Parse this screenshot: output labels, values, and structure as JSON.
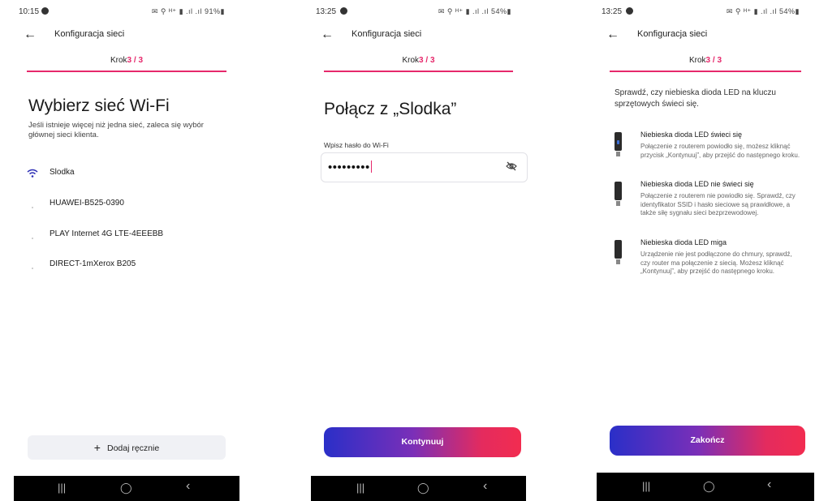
{
  "screens": [
    {
      "time": "10:15",
      "status_right": "✉ ⚲ ᴴ⁺ ▮ .ıl .ıl 91%▮",
      "title": "Konfiguracja sieci",
      "step_label": "Krok",
      "step_num": "3 / 3",
      "heading": "Wybierz sieć Wi-Fi",
      "subtitle": "Jeśli istnieje więcej niż jedna sieć, zaleca się wybór głównej sieci klienta.",
      "networks": [
        {
          "name": "Slodka",
          "icon": "wifi-icon"
        },
        {
          "name": "HUAWEI-B525-0390",
          "icon": "wifi-weak-icon"
        },
        {
          "name": "PLAY Internet 4G LTE-4EEEBB",
          "icon": "wifi-weak-icon"
        },
        {
          "name": "DIRECT-1mXerox B205",
          "icon": "wifi-weak-icon"
        }
      ],
      "add_button": "Dodaj ręcznie"
    },
    {
      "time": "13:25",
      "status_right": "✉ ⚲ ᴴ⁺ ▮ .ıl .ıl 54%▮",
      "title": "Konfiguracja sieci",
      "step_label": "Krok",
      "step_num": "3 / 3",
      "heading": "Połącz z „Slodka”",
      "field_label": "Wpisz hasło do Wi-Fi",
      "password_mask": "•••••••••",
      "continue_button": "Kontynuuj"
    },
    {
      "time": "13:25",
      "status_right": "✉ ⚲ ᴴ⁺ ▮ .ıl .ıl 54%▮",
      "title": "Konfiguracja sieci",
      "step_label": "Krok",
      "step_num": "3 / 3",
      "intro": "Sprawdź, czy niebieska dioda LED na kluczu sprzętowych świeci się.",
      "leds": [
        {
          "title": "Niebieska dioda LED świeci się",
          "desc": "Połączenie z routerem powiodło się, możesz kliknąć przycisk „Kontynuuj”, aby przejść do następnego kroku.",
          "light": true
        },
        {
          "title": "Niebieska dioda LED nie świeci się",
          "desc": "Połączenie z routerem nie powiodło się. Sprawdź, czy identyfikator SSID i hasło sieciowe są prawidłowe, a także siłę sygnału sieci bezprzewodowej.",
          "light": false
        },
        {
          "title": "Niebieska dioda LED miga",
          "desc": "Urządzenie nie jest podłączone do chmury, sprawdź, czy router ma połączenie z siecią. Możesz kliknąć „Kontynuuj”, aby przejść do następnego kroku.",
          "light": false
        }
      ],
      "finish_button": "Zakończ"
    }
  ],
  "navbar": {
    "recents": "|||",
    "home": "◯",
    "back": "‹"
  },
  "colors": {
    "accent": "#e6286b",
    "gradient_start": "#2a2fc8",
    "gradient_end": "#f22c50"
  }
}
